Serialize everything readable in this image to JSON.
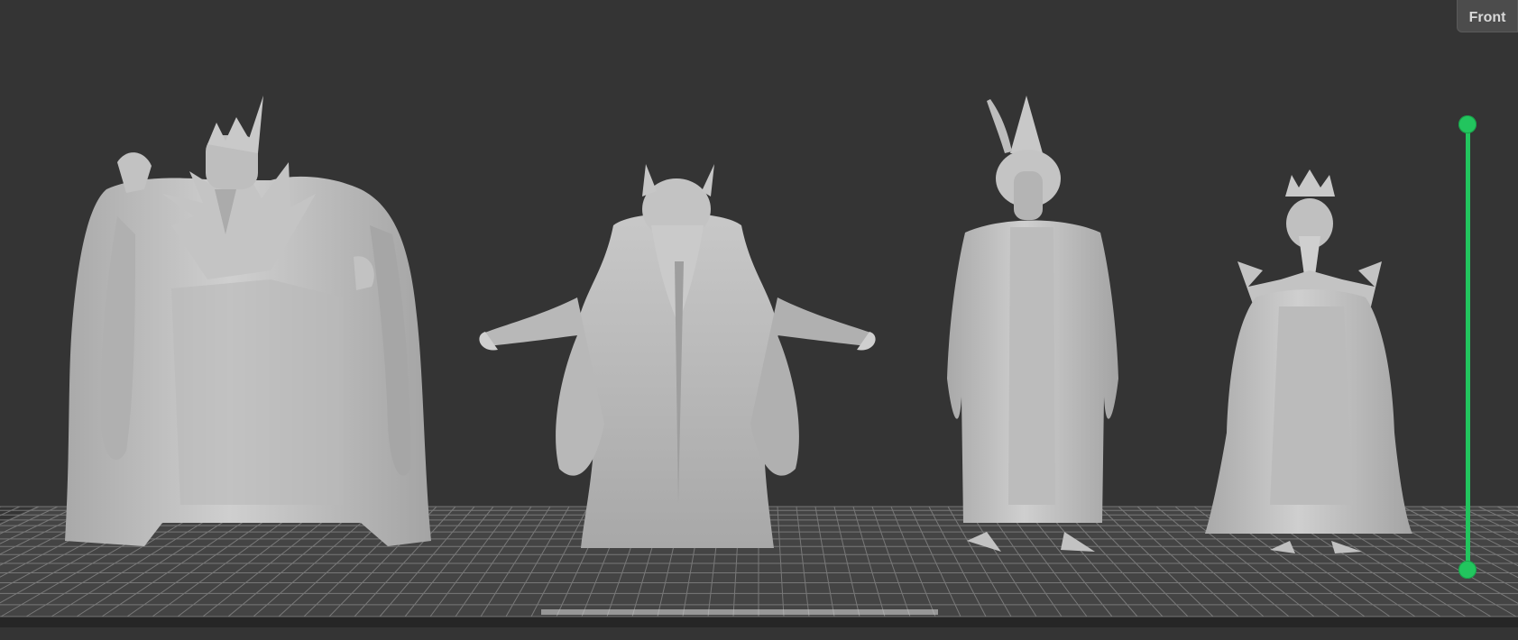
{
  "view_tab": {
    "label": "Front"
  },
  "layer_slider": {
    "color": "#22c55e",
    "top_level": 1.0,
    "bottom_level": 0.0
  },
  "scene": {
    "background": "#343434",
    "plate_color": "#444444",
    "grid_color": "#9a9a9a",
    "model_color": "#bdbdbd",
    "models": [
      {
        "name": "king-large-robed-figure"
      },
      {
        "name": "wizard-open-arms"
      },
      {
        "name": "pointed-hat-tall-figure"
      },
      {
        "name": "crowned-bearded-king"
      }
    ]
  }
}
